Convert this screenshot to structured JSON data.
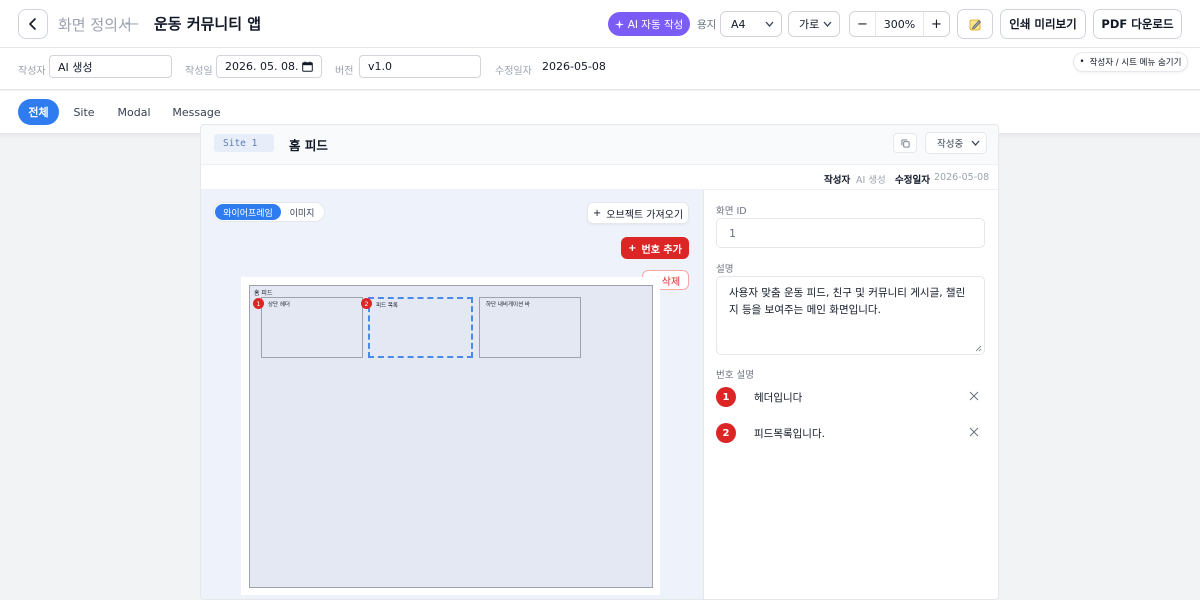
{
  "header": {
    "doc_type": "화면 정의서",
    "dash": "—",
    "title": "운동 커뮤니티 앱",
    "ai_button": "AI 자동 작성",
    "paper_label": "용지",
    "paper_value": "A4",
    "orientation_value": "가로",
    "zoom_minus": "−",
    "zoom_value": "300%",
    "zoom_plus": "+",
    "print_preview": "인쇄 미리보기",
    "pdf_download": "PDF 다운로드"
  },
  "meta": {
    "author_label": "작성자",
    "author_value": "AI 생성",
    "date_label": "작성일",
    "date_value": "2026. 05. 08.",
    "version_label": "버전",
    "version_value": "v1.0",
    "modified_label": "수정일자",
    "modified_value": "2026-05-08",
    "hide_menu_button": "작성자 / 시트 메뉴 숨기기"
  },
  "tabs": [
    {
      "label": "전체",
      "active": true
    },
    {
      "label": "Site",
      "active": false
    },
    {
      "label": "Modal",
      "active": false
    },
    {
      "label": "Message",
      "active": false
    }
  ],
  "card": {
    "badge": "Site 1",
    "title": "홈 피드",
    "status": "작성중",
    "author_label": "작성자",
    "author_value": "AI 생성",
    "modified_label": "수정일자",
    "modified_value": "2026-05-08"
  },
  "canvas_pane": {
    "view_wireframe": "와이어프레임",
    "view_image": "이미지",
    "import_object": "오브젝트 가져오기",
    "add_number": "번호 추가",
    "delete": "삭제",
    "frame_title": "홈 피드",
    "boxes": [
      {
        "label": "상단 헤더",
        "number": "1"
      },
      {
        "label": "피드 목록",
        "number": "2"
      },
      {
        "label": "하단 내비게이션 바",
        "number": ""
      }
    ]
  },
  "form": {
    "screen_id_label": "화면 ID",
    "screen_id_value": "1",
    "description_label": "설명",
    "description_value": "사용자 맞춤 운동 피드, 친구 및 커뮤니티 게시글, 챌린지 등을 보여주는 메인 화면입니다.",
    "numbers_label": "번호 설명",
    "numbers": [
      {
        "number": "1",
        "text": "헤더입니다"
      },
      {
        "number": "2",
        "text": "피드목록입니다."
      }
    ]
  },
  "icons": {
    "back": "chevron-left-icon",
    "ai": "sparkle-icon",
    "note": "memo-icon",
    "copy": "copy-icon",
    "calendar": "calendar-icon",
    "remove": "close-icon"
  },
  "colors": {
    "accent": "#2f7cf0",
    "ai": "#7c5cf6",
    "danger": "#dc2626"
  }
}
